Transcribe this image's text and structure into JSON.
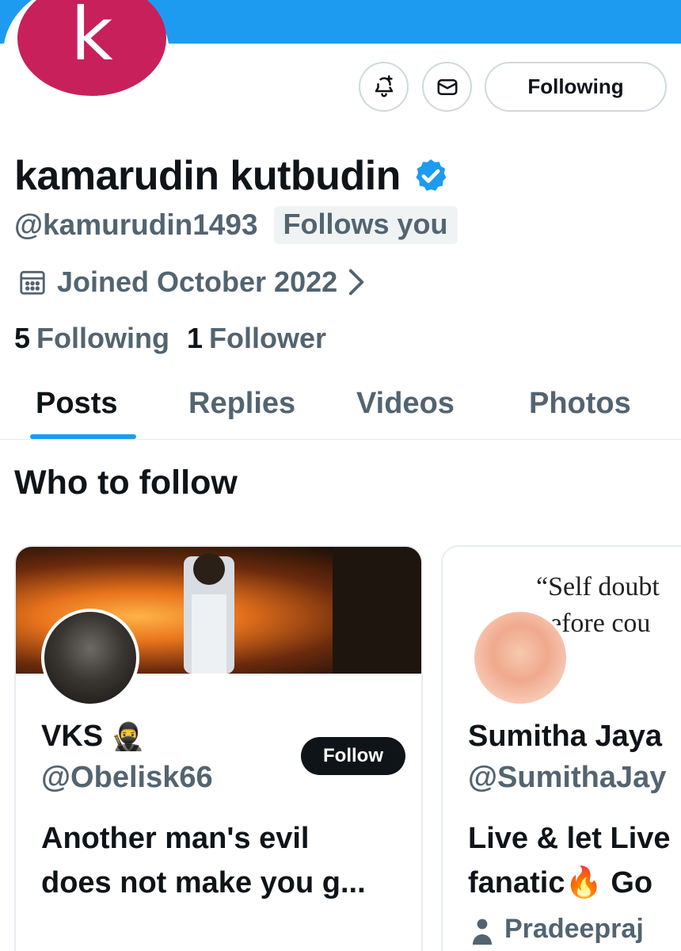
{
  "profile": {
    "avatar_letter": "k",
    "display_name": "kamarudin kutbudin",
    "handle": "@kamurudin1493",
    "follows_you": "Follows you",
    "joined": "Joined October 2022",
    "following_count": "5",
    "following_label": "Following",
    "followers_count": "1",
    "followers_label": "Follower",
    "follow_state_label": "Following"
  },
  "icons": {
    "notify": "bell-plus-icon",
    "message": "envelope-icon",
    "verified": "verified-badge-icon",
    "calendar": "calendar-icon",
    "chevron": "chevron-right-icon"
  },
  "tabs": [
    {
      "label": "Posts",
      "active": true
    },
    {
      "label": "Replies",
      "active": false
    },
    {
      "label": "Videos",
      "active": false
    },
    {
      "label": "Photos",
      "active": false
    }
  ],
  "who_to_follow": {
    "title": "Who to follow",
    "cards": [
      {
        "name": "VKS",
        "emoji": "🥷",
        "handle": "@Obelisk66",
        "bio_line1": "Another man's evil",
        "bio_line2": "does not make you g...",
        "follow_label": "Follow"
      },
      {
        "name": "Sumitha Jaya",
        "handle": "@SumithaJay",
        "bio_line1": "Live & let Live",
        "bio_line2": "fanatic🔥 Go",
        "banner_quote_line1": "“Self doubt",
        "banner_quote_line2": "before cou",
        "mutual": "Pradeepraj"
      }
    ]
  },
  "colors": {
    "brand": "#1d9bf0",
    "avatar_bg": "#c8205a",
    "text_primary": "#0f1419",
    "text_secondary": "#536471"
  }
}
